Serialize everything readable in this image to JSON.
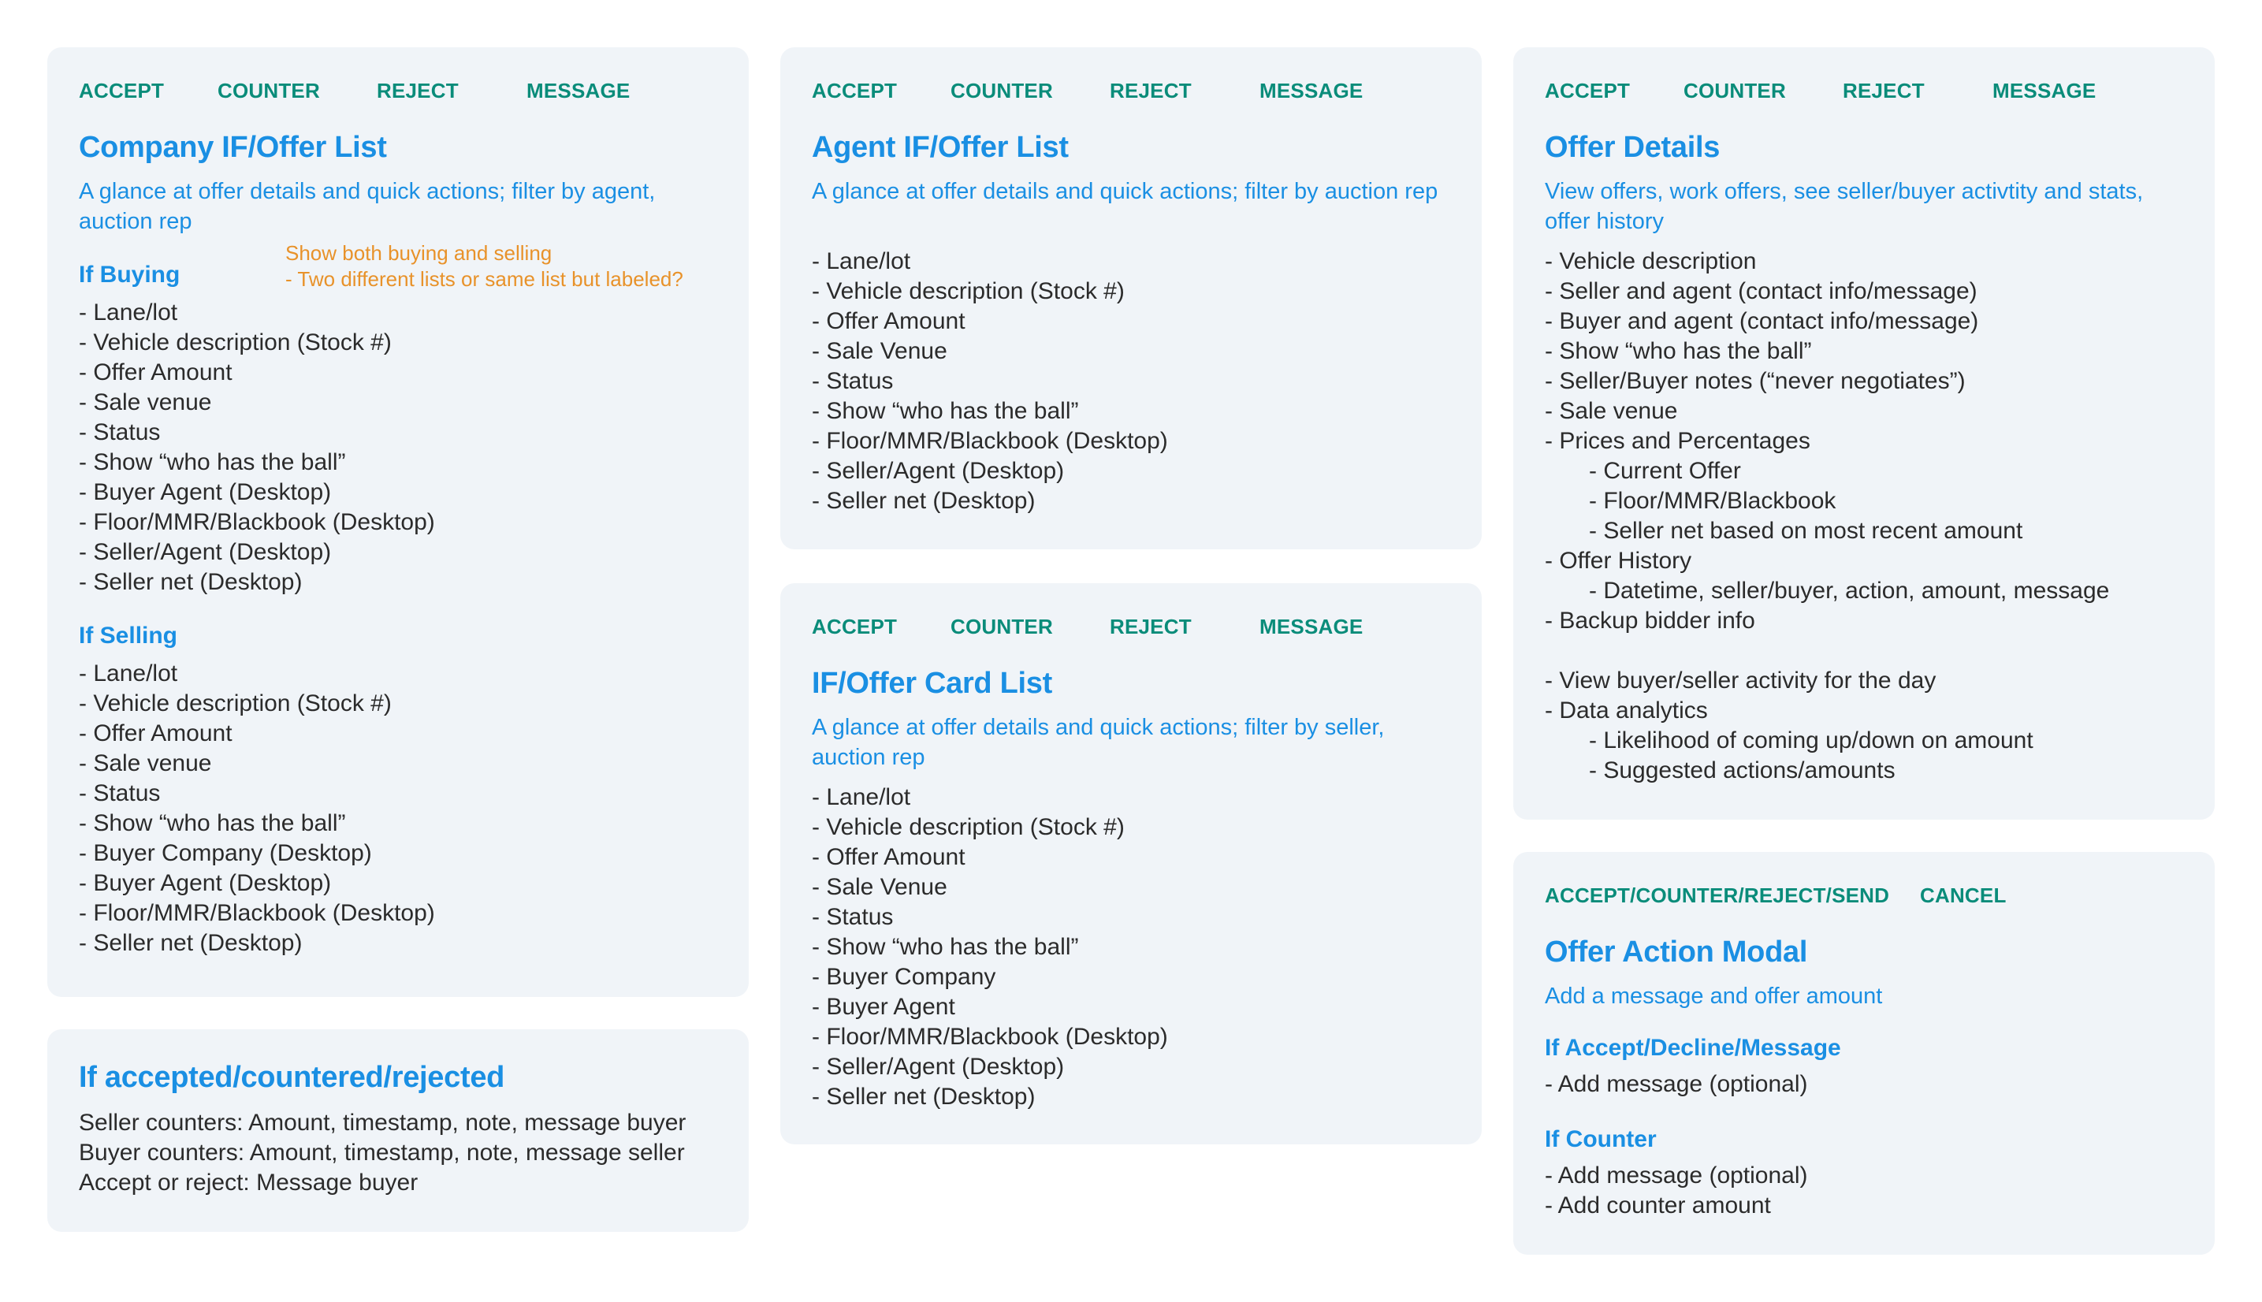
{
  "colors": {
    "action": "#0a8c7a",
    "heading": "#1a8fe3",
    "note": "#e8922a",
    "card_bg": "#f0f4f8",
    "body_text": "#2b2b2b"
  },
  "company_list": {
    "actions": [
      "ACCEPT",
      "COUNTER",
      "REJECT",
      "MESSAGE"
    ],
    "title": "Company IF/Offer List",
    "description": "A glance at offer details and quick actions; filter by agent, auction rep",
    "note": [
      "Show both buying and selling",
      "- Two different lists or same list but labeled?"
    ],
    "buying": {
      "heading": "If Buying",
      "items": [
        "- Lane/lot",
        "- Vehicle description (Stock #)",
        "- Offer Amount",
        "- Sale venue",
        "- Status",
        "- Show “who has the ball”",
        "- Buyer Agent (Desktop)",
        "- Floor/MMR/Blackbook (Desktop)",
        "- Seller/Agent (Desktop)",
        "- Seller net (Desktop)"
      ]
    },
    "selling": {
      "heading": "If Selling",
      "items": [
        "- Lane/lot",
        "- Vehicle description (Stock #)",
        "- Offer Amount",
        "- Sale venue",
        "- Status",
        "- Show “who has the ball”",
        "- Buyer Company (Desktop)",
        "- Buyer Agent (Desktop)",
        "- Floor/MMR/Blackbook (Desktop)",
        "- Seller net (Desktop)"
      ]
    }
  },
  "outcome": {
    "title": "If accepted/countered/rejected",
    "lines": [
      "Seller counters: Amount, timestamp, note, message buyer",
      "Buyer counters: Amount, timestamp, note, message seller",
      "Accept or reject: Message buyer"
    ]
  },
  "agent_list": {
    "actions": [
      "ACCEPT",
      "COUNTER",
      "REJECT",
      "MESSAGE"
    ],
    "title": "Agent IF/Offer List",
    "description": "A glance at offer details and quick actions; filter by auction rep",
    "items": [
      "- Lane/lot",
      "- Vehicle description (Stock #)",
      "- Offer Amount",
      "- Sale Venue",
      "- Status",
      "- Show “who has the ball”",
      "- Floor/MMR/Blackbook (Desktop)",
      "- Seller/Agent (Desktop)",
      "- Seller net (Desktop)"
    ]
  },
  "card_list": {
    "actions": [
      "ACCEPT",
      "COUNTER",
      "REJECT",
      "MESSAGE"
    ],
    "title": "IF/Offer Card List",
    "description": "A glance at offer details and quick actions; filter by seller, auction rep",
    "items": [
      "- Lane/lot",
      "- Vehicle description (Stock #)",
      "- Offer Amount",
      "- Sale Venue",
      "- Status",
      "- Show “who has the ball”",
      "- Buyer Company",
      "- Buyer Agent",
      "- Floor/MMR/Blackbook (Desktop)",
      "- Seller/Agent (Desktop)",
      "- Seller net (Desktop)"
    ]
  },
  "offer_details": {
    "actions": [
      "ACCEPT",
      "COUNTER",
      "REJECT",
      "MESSAGE"
    ],
    "title": "Offer Details",
    "description": "View offers, work offers, see seller/buyer activtity and stats, offer history",
    "items": [
      {
        "text": "- Vehicle description",
        "indent": false
      },
      {
        "text": "- Seller and agent (contact info/message)",
        "indent": false
      },
      {
        "text": "- Buyer and agent (contact info/message)",
        "indent": false
      },
      {
        "text": "- Show “who has the ball”",
        "indent": false
      },
      {
        "text": "- Seller/Buyer notes (“never negotiates”)",
        "indent": false
      },
      {
        "text": "- Sale venue",
        "indent": false
      },
      {
        "text": "- Prices and Percentages",
        "indent": false
      },
      {
        "text": "- Current Offer",
        "indent": true
      },
      {
        "text": "- Floor/MMR/Blackbook",
        "indent": true
      },
      {
        "text": "- Seller net based on most recent amount",
        "indent": true
      },
      {
        "text": "- Offer History",
        "indent": false
      },
      {
        "text": "- Datetime, seller/buyer, action, amount, message",
        "indent": true
      },
      {
        "text": "- Backup bidder info",
        "indent": false
      },
      {
        "text": "",
        "indent": false
      },
      {
        "text": "- View buyer/seller activity for the day",
        "indent": false
      },
      {
        "text": "- Data analytics",
        "indent": false
      },
      {
        "text": "- Likelihood of coming up/down on amount",
        "indent": true
      },
      {
        "text": "- Suggested actions/amounts",
        "indent": true
      }
    ]
  },
  "action_modal": {
    "actions": [
      "ACCEPT/COUNTER/REJECT/SEND",
      "CANCEL"
    ],
    "title": "Offer Action Modal",
    "description": "Add a message and offer amount",
    "accept_section": {
      "heading": "If Accept/Decline/Message",
      "items": [
        "- Add message (optional)"
      ]
    },
    "counter_section": {
      "heading": "If Counter",
      "items": [
        "- Add message (optional)",
        "- Add counter amount"
      ]
    }
  }
}
